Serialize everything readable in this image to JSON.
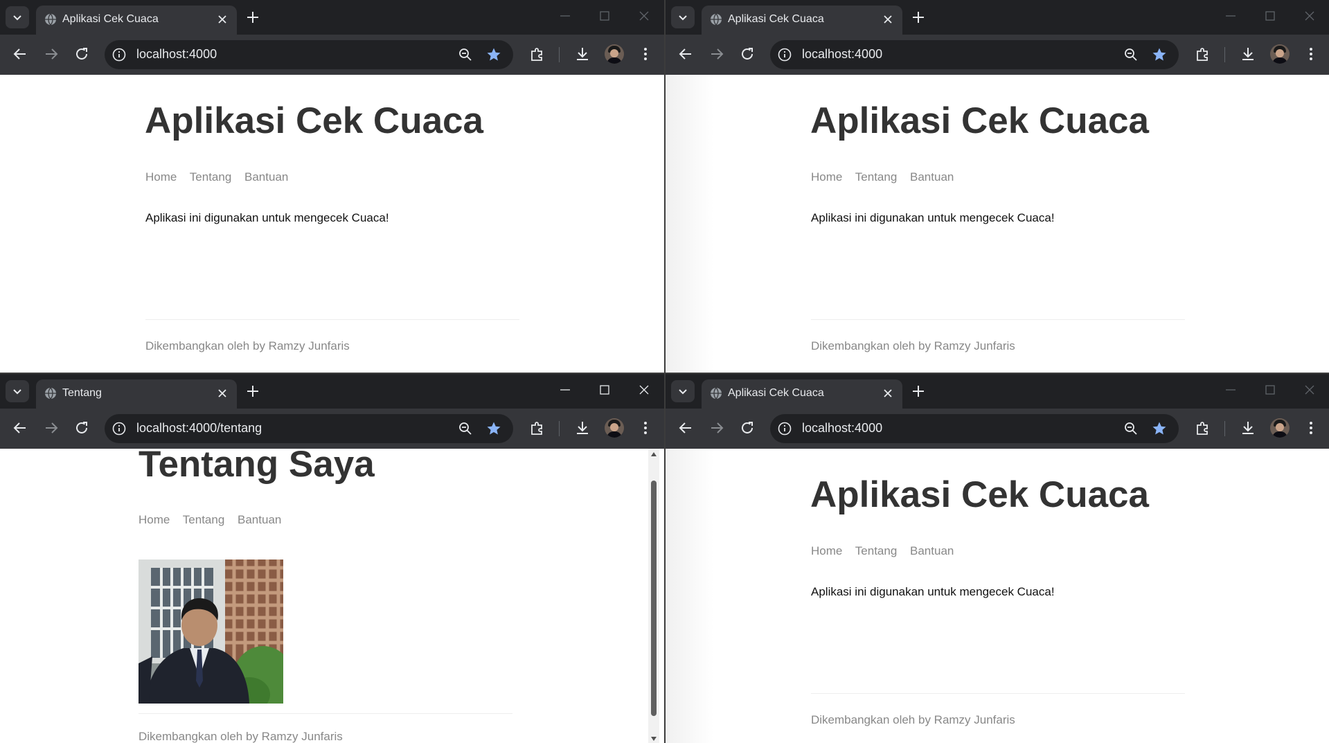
{
  "windows": [
    {
      "tab_title": "Aplikasi Cek Cuaca",
      "url": "localhost:4000",
      "heading": "Aplikasi Cek Cuaca",
      "nav": [
        "Home",
        "Tentang",
        "Bantuan"
      ],
      "body_text": "Aplikasi ini digunakan untuk mengecek Cuaca!",
      "footer": "Dikembangkan oleh by Ramzy Junfaris"
    },
    {
      "tab_title": "Aplikasi Cek Cuaca",
      "url": "localhost:4000",
      "heading": "Aplikasi Cek Cuaca",
      "nav": [
        "Home",
        "Tentang",
        "Bantuan"
      ],
      "body_text": "Aplikasi ini digunakan untuk mengecek Cuaca!",
      "footer": "Dikembangkan oleh by Ramzy Junfaris"
    },
    {
      "tab_title": "Tentang",
      "url": "localhost:4000/tentang",
      "heading": "Tentang Saya",
      "nav": [
        "Home",
        "Tentang",
        "Bantuan"
      ],
      "footer": "Dikembangkan oleh by Ramzy Junfaris"
    },
    {
      "tab_title": "Aplikasi Cek Cuaca",
      "url": "localhost:4000",
      "heading": "Aplikasi Cek Cuaca",
      "nav": [
        "Home",
        "Tentang",
        "Bantuan"
      ],
      "body_text": "Aplikasi ini digunakan untuk mengecek Cuaca!",
      "footer": "Dikembangkan oleh by Ramzy Junfaris"
    }
  ],
  "icons": {
    "tab_search": "chevron-down-icon",
    "favicon": "globe-icon",
    "tab_close": "close-icon",
    "new_tab": "plus-icon",
    "minimize": "minimize-icon",
    "maximize": "maximize-icon",
    "close_window": "close-icon",
    "back": "back-arrow-icon",
    "forward": "forward-arrow-icon",
    "reload": "reload-icon",
    "site_info": "info-icon",
    "zoom": "zoom-out-icon",
    "bookmark": "star-icon",
    "extensions": "puzzle-icon",
    "downloads": "download-icon",
    "menu": "kebab-menu-icon"
  },
  "colors": {
    "chrome_dark": "#202124",
    "chrome_toolbar": "#35363a",
    "bookmark_star": "#8ab4f8",
    "heading": "#333333",
    "nav_link": "#888888"
  }
}
